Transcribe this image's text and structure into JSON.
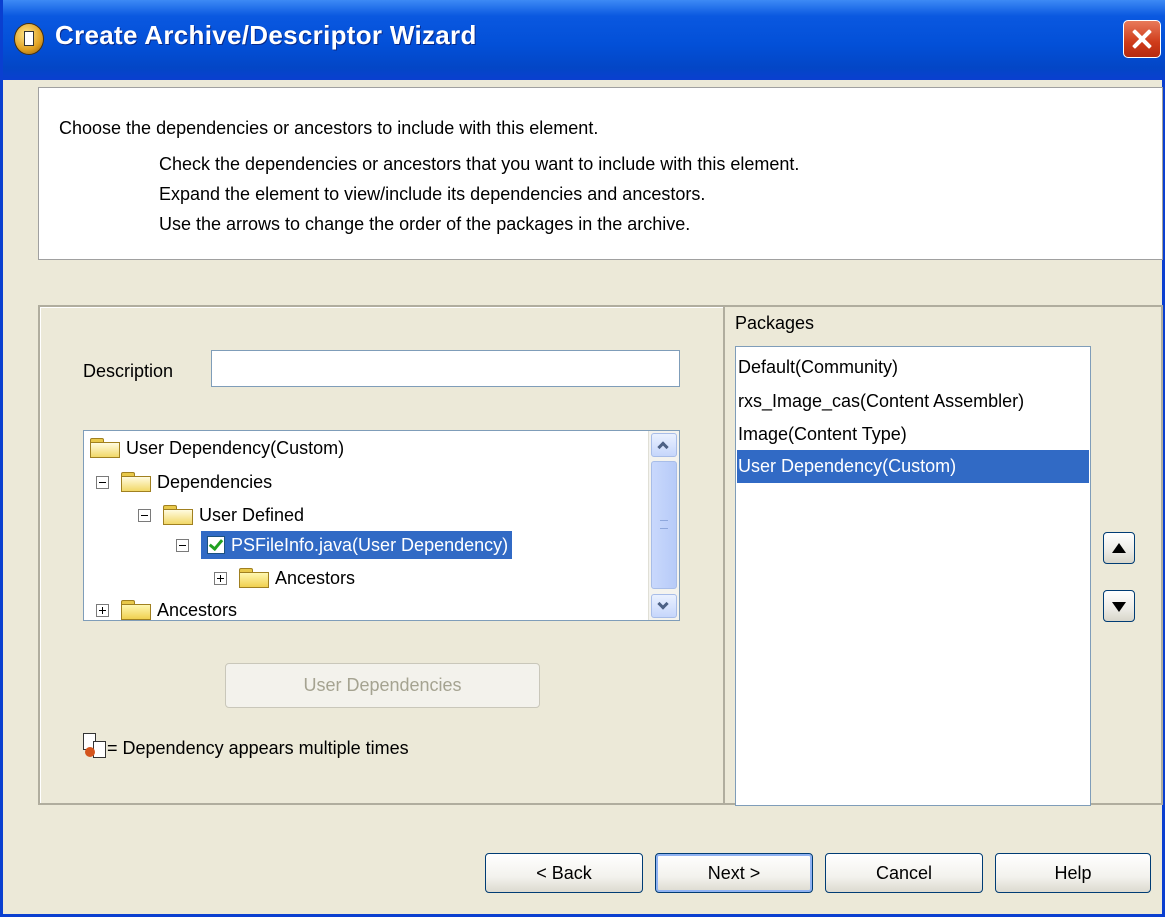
{
  "window": {
    "title": "Create Archive/Descriptor Wizard"
  },
  "info": {
    "heading": "Choose the dependencies or ancestors to include with this element.",
    "lines": [
      "Check the dependencies or ancestors that you want to include with this element.",
      "Expand the element to view/include its dependencies and ancestors.",
      "Use the arrows to change the order of the packages in the archive."
    ]
  },
  "description": {
    "label": "Description",
    "value": ""
  },
  "tree": {
    "items": [
      {
        "label": "User Dependency(Custom)",
        "expander": "none",
        "icon": "open-folder-icon"
      },
      {
        "label": "Dependencies",
        "expander": "collapse",
        "icon": "open-folder-icon"
      },
      {
        "label": "User Defined",
        "expander": "collapse",
        "icon": "open-folder-icon"
      },
      {
        "label": "PSFileInfo.java(User Dependency)",
        "expander": "collapse",
        "icon": "checkbox-checked",
        "checked": true,
        "selected": true
      },
      {
        "label": "Ancestors",
        "expander": "expand",
        "icon": "folder-icon"
      },
      {
        "label": "Ancestors",
        "expander": "expand",
        "icon": "folder-icon"
      }
    ]
  },
  "user_dependencies_button": {
    "label": "User Dependencies",
    "enabled": false
  },
  "legend": {
    "text": "= Dependency appears multiple times",
    "icon": "multiple-dependency-icon"
  },
  "packages": {
    "label": "Packages",
    "items": [
      {
        "label": "Default(Community)"
      },
      {
        "label": "rxs_Image_cas(Content Assembler)"
      },
      {
        "label": "Image(Content Type)"
      },
      {
        "label": "User Dependency(Custom)",
        "selected": true
      }
    ]
  },
  "footer": {
    "back": "< Back",
    "next": "Next >",
    "cancel": "Cancel",
    "help": "Help"
  },
  "colors": {
    "title_bar": "#0350d8",
    "selection": "#316ac5",
    "dialog_bg": "#ece9d8",
    "close_button": "#cf3b1a"
  }
}
